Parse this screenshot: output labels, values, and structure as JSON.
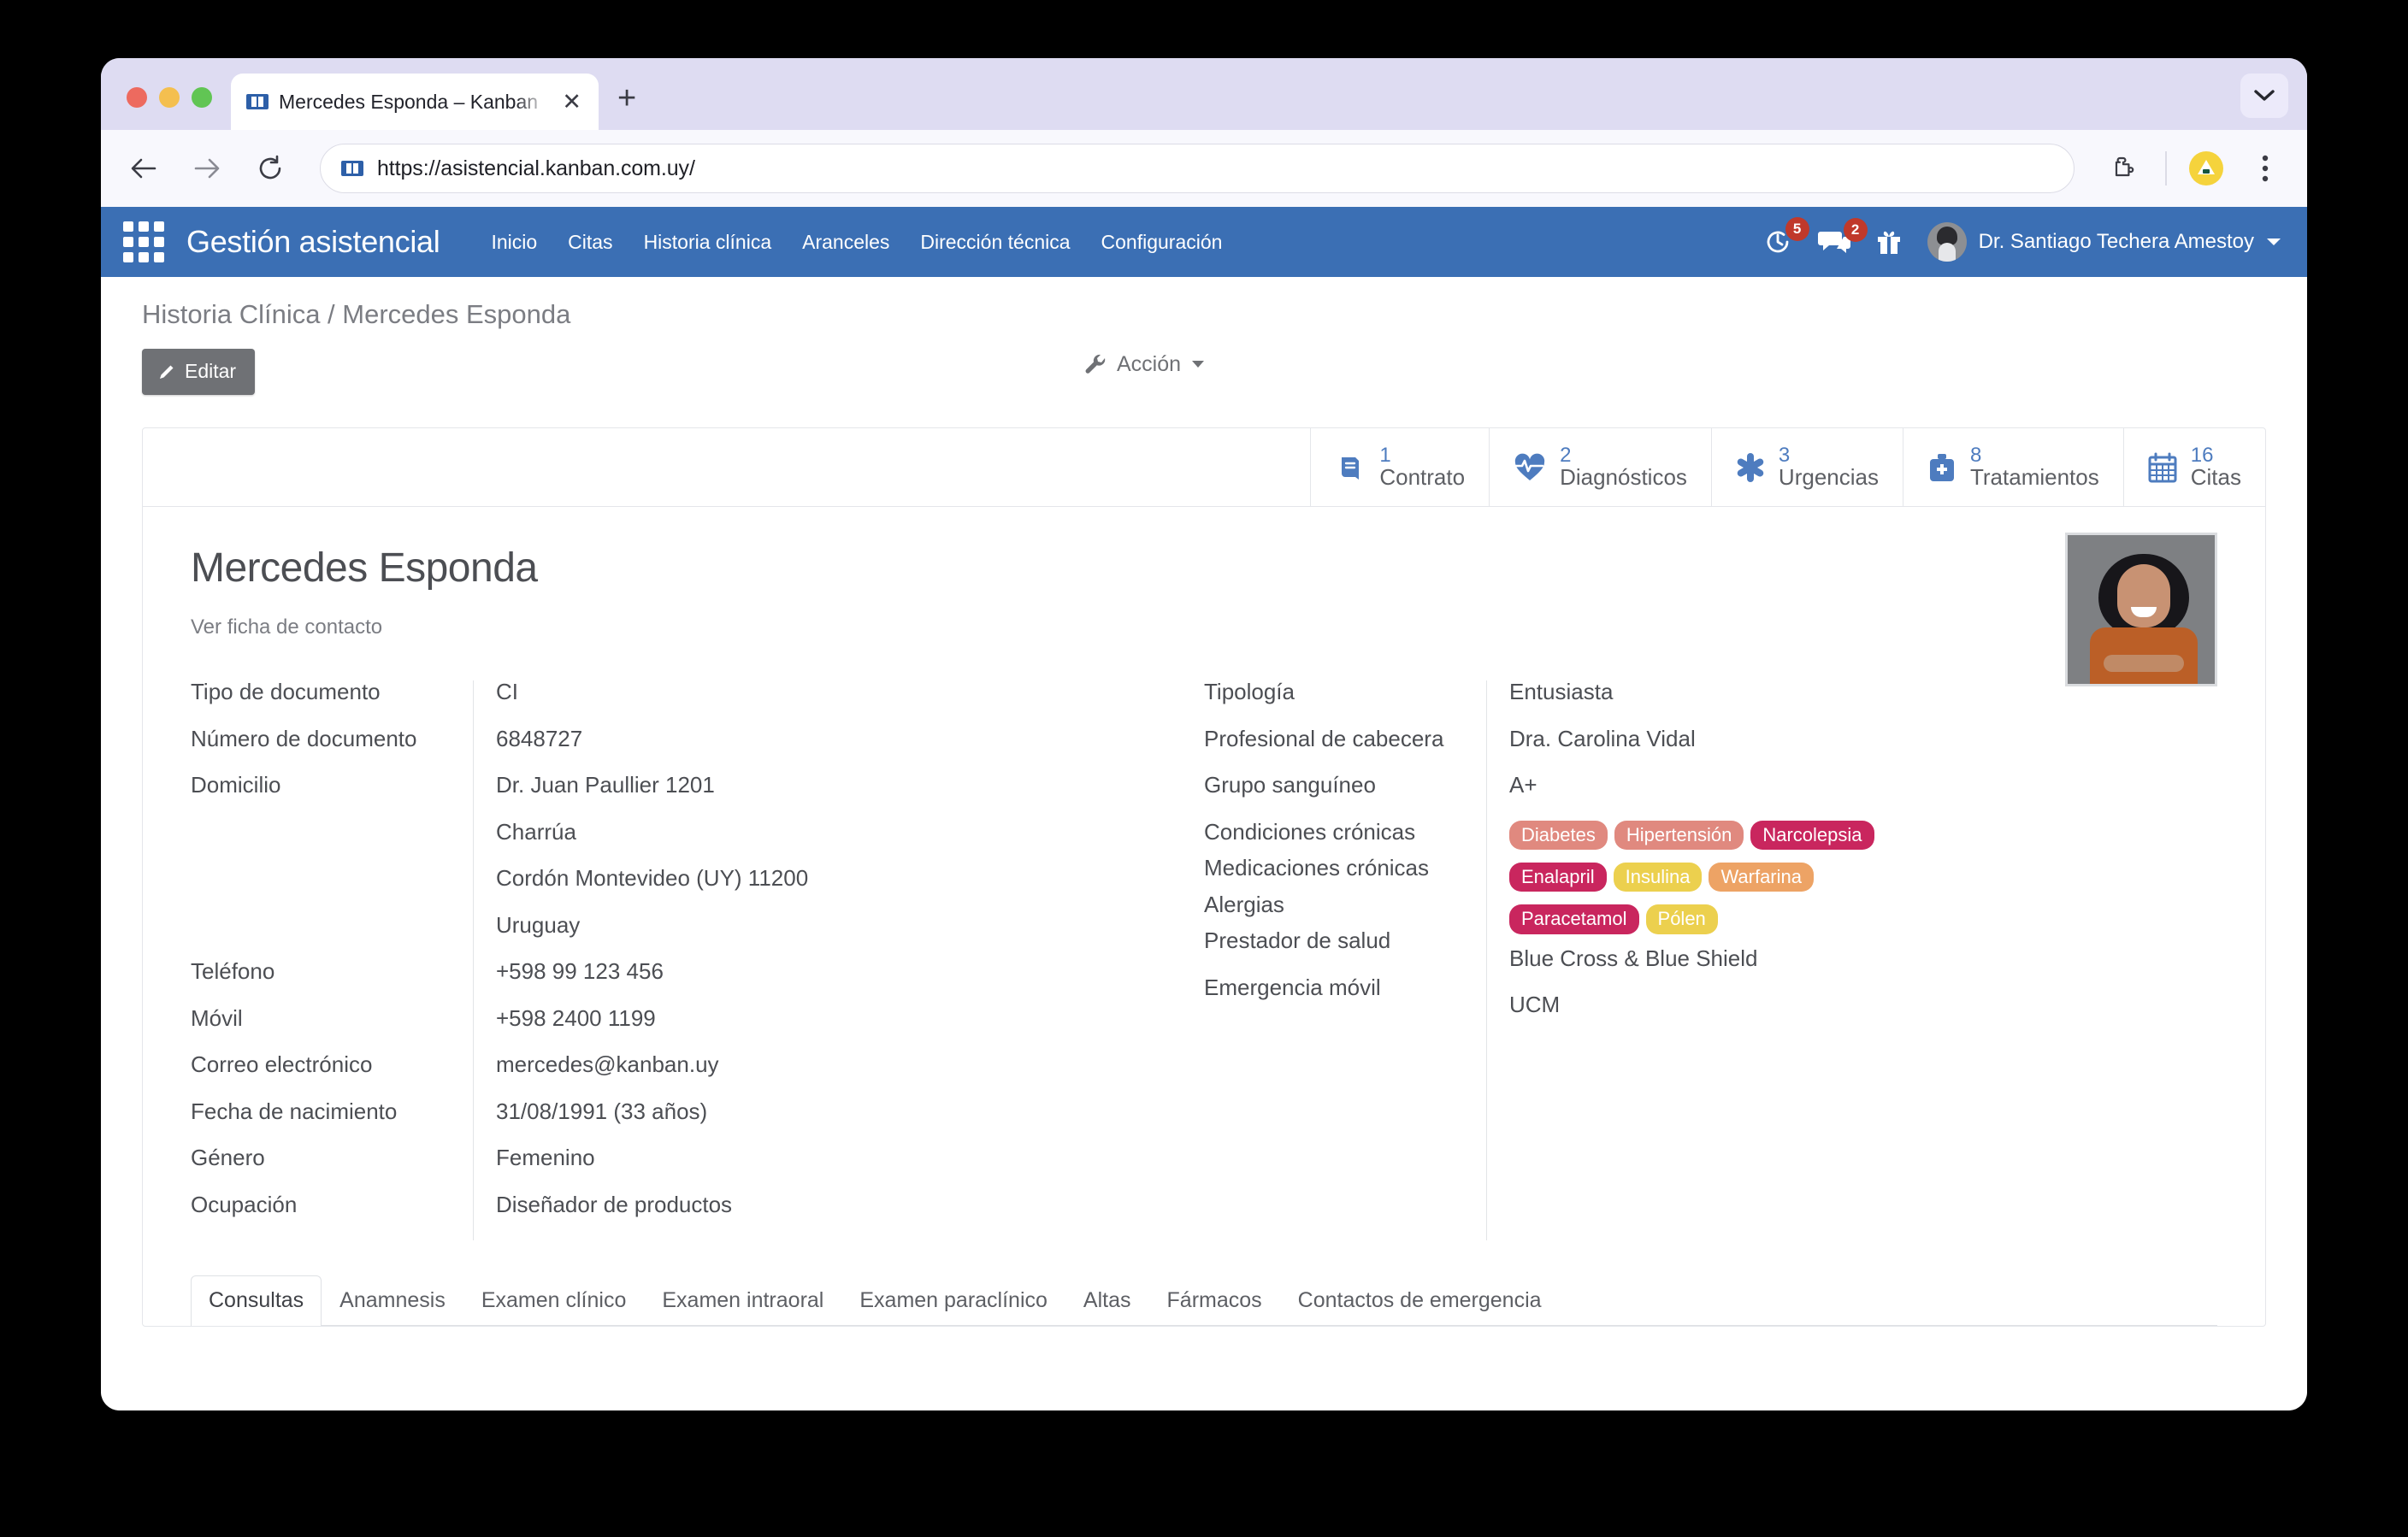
{
  "browser": {
    "tab_title": "Mercedes Esponda – Kanban",
    "favicon_name": "kanban-favicon",
    "close_label": "✕",
    "newtab_label": "+",
    "url": "https://asistencial.kanban.com.uy/"
  },
  "appbar": {
    "brand": "Gestión asistencial",
    "nav": [
      {
        "label": "Inicio"
      },
      {
        "label": "Citas"
      },
      {
        "label": "Historia clínica"
      },
      {
        "label": "Aranceles"
      },
      {
        "label": "Dirección técnica"
      },
      {
        "label": "Configuración"
      }
    ],
    "activity_count": "5",
    "messages_count": "2",
    "user_name": "Dr. Santiago Techera Amestoy",
    "accent_color": "#3b6fb4"
  },
  "page": {
    "breadcrumb": "Historia Clínica / Mercedes Esponda",
    "edit_label": "Editar",
    "action_label": "Acción"
  },
  "stats": [
    {
      "count": "1",
      "label": "Contrato",
      "icon": "book-icon"
    },
    {
      "count": "2",
      "label": "Diagnósticos",
      "icon": "heartbeat-icon"
    },
    {
      "count": "3",
      "label": "Urgencias",
      "icon": "asterisk-icon"
    },
    {
      "count": "8",
      "label": "Tratamientos",
      "icon": "medkit-icon"
    },
    {
      "count": "16",
      "label": "Citas",
      "icon": "calendar-icon"
    }
  ],
  "patient": {
    "name": "Mercedes Esponda",
    "contact_link": "Ver ficha de contacto",
    "photo_alt": "patient-photo"
  },
  "left_fields": {
    "labels": [
      "Tipo de documento",
      "Número de documento",
      "Domicilio",
      "",
      "",
      "",
      "Teléfono",
      "Móvil",
      "Correo electrónico",
      "Fecha de nacimiento",
      "Género",
      "Ocupación"
    ],
    "values": [
      "CI",
      "6848727",
      "Dr. Juan Paullier 1201",
      "Charrúa",
      "Cordón  Montevideo (UY)  11200",
      "Uruguay",
      "+598 99 123 456",
      "+598 2400 1199",
      "mercedes@kanban.uy",
      "31/08/1991 (33 años)",
      "Femenino",
      "Diseñador de productos"
    ]
  },
  "right_fields": {
    "labels": [
      "Tipología",
      "Profesional de cabecera",
      "Grupo sanguíneo",
      "Condiciones crónicas",
      "Medicaciones crónicas",
      "Alergias",
      "Prestador de salud",
      "Emergencia móvil"
    ],
    "values": {
      "tipologia": "Entusiasta",
      "profesional": "Dra. Carolina Vidal",
      "grupo_sanguineo": "A+",
      "prestador": "Blue Cross & Blue Shield",
      "emergencia": "UCM"
    },
    "condiciones_cronicas": [
      {
        "label": "Diabetes",
        "color": "#e0897f"
      },
      {
        "label": "Hipertensión",
        "color": "#e0897f"
      },
      {
        "label": "Narcolepsia",
        "color": "#c9265e"
      }
    ],
    "medicaciones_cronicas": [
      {
        "label": "Enalapril",
        "color": "#c9265e"
      },
      {
        "label": "Insulina",
        "color": "#ecd04e"
      },
      {
        "label": "Warfarina",
        "color": "#eda365"
      }
    ],
    "alergias": [
      {
        "label": "Paracetamol",
        "color": "#c9265e"
      },
      {
        "label": "Pólen",
        "color": "#ecd04e"
      }
    ]
  },
  "tabs": [
    {
      "label": "Consultas",
      "active": true
    },
    {
      "label": "Anamnesis",
      "active": false
    },
    {
      "label": "Examen clínico",
      "active": false
    },
    {
      "label": "Examen intraoral",
      "active": false
    },
    {
      "label": "Examen paraclínico",
      "active": false
    },
    {
      "label": "Altas",
      "active": false
    },
    {
      "label": "Fármacos",
      "active": false
    },
    {
      "label": "Contactos de emergencia",
      "active": false
    }
  ]
}
